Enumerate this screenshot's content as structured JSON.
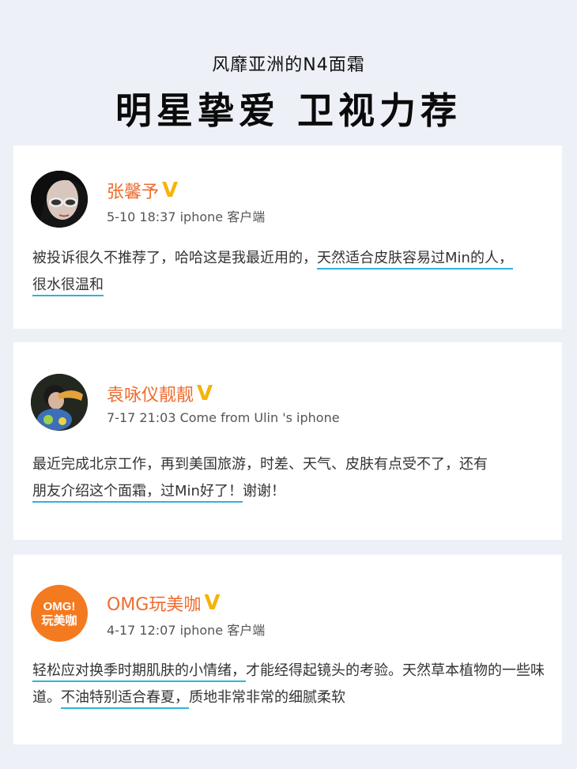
{
  "header": {
    "subtitle": "风靡亚洲的N4面霜",
    "title": "明星挚爱 卫视力荐"
  },
  "posts": [
    {
      "name": "张馨予",
      "verified_mark": "V",
      "meta": "5-10 18:37  iphone 客户端",
      "segments": [
        {
          "text": "被投诉很久不推荐了，哈哈这是我最近用的，",
          "hl": false
        },
        {
          "text": "天然适合皮肤容易过Min的人，",
          "hl": true
        },
        {
          "text": "很水很温和",
          "hl": true
        }
      ]
    },
    {
      "name": "袁咏仪靓靓",
      "verified_mark": "V",
      "meta": "7-17 21:03  Come from  Ulin 's  iphone",
      "segments": [
        {
          "text": "最近完成北京工作，再到美国旅游，时差、天气、皮肤有点受不了，还有",
          "hl": false
        },
        {
          "text": "朋友介绍这个面霜，过Min好了！",
          "hl": true
        },
        {
          "text": "谢谢！",
          "hl": false
        }
      ]
    },
    {
      "name": "OMG玩美咖",
      "verified_mark": "V",
      "meta": "4-17 12:07  iphone 客户端",
      "avatar_logo": {
        "line1": "OMG!",
        "line2": "玩美咖"
      },
      "segments": [
        {
          "text": "轻松应对换季时期肌肤的小情绪，",
          "hl": true
        },
        {
          "text": "才能经得起镜头的考验。天然草本植物的一些味道。",
          "hl": false
        },
        {
          "text": "不油特别适合春夏，",
          "hl": true
        },
        {
          "text": "质地非常非常的细腻柔软",
          "hl": false
        }
      ]
    }
  ],
  "colors": {
    "background": "#eef0f7",
    "name": "#ef6b2d",
    "verified": "#f4b40a",
    "highlight_underline": "#2db4d8",
    "omg_badge": "#f47a20"
  }
}
